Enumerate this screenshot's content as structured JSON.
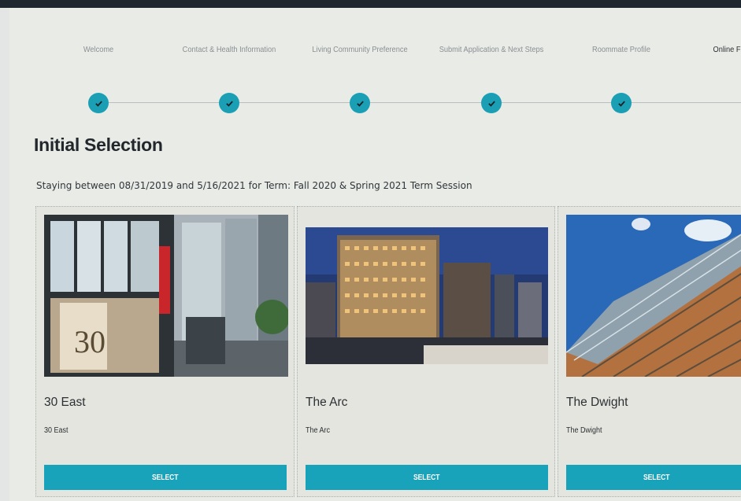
{
  "stepper": {
    "steps": [
      {
        "label": "Welcome",
        "completed": true
      },
      {
        "label": "Contact & Health Information",
        "completed": true
      },
      {
        "label": "Living Community Preference",
        "completed": true
      },
      {
        "label": "Submit Application & Next Steps",
        "completed": true
      },
      {
        "label": "Roommate Profile",
        "completed": true
      },
      {
        "label": "Online F",
        "completed": false,
        "current": true
      }
    ]
  },
  "page": {
    "title": "Initial Selection",
    "staying_text": "Staying between 08/31/2019 and 5/16/2021 for Term: Fall 2020 & Spring 2021 Term Session"
  },
  "cards": [
    {
      "title": "30 East",
      "subtitle": "30 East",
      "button": "SELECT",
      "image_icon": "building-photo-30-east"
    },
    {
      "title": "The Arc",
      "subtitle": "The Arc",
      "button": "SELECT",
      "image_icon": "building-photo-the-arc"
    },
    {
      "title": "The Dwight",
      "subtitle": "The Dwight",
      "button": "SELECT",
      "image_icon": "building-photo-the-dwight"
    }
  ],
  "colors": {
    "accent": "#19a3bb",
    "top_bar": "#1e2630",
    "background": "#e9ebe7"
  }
}
